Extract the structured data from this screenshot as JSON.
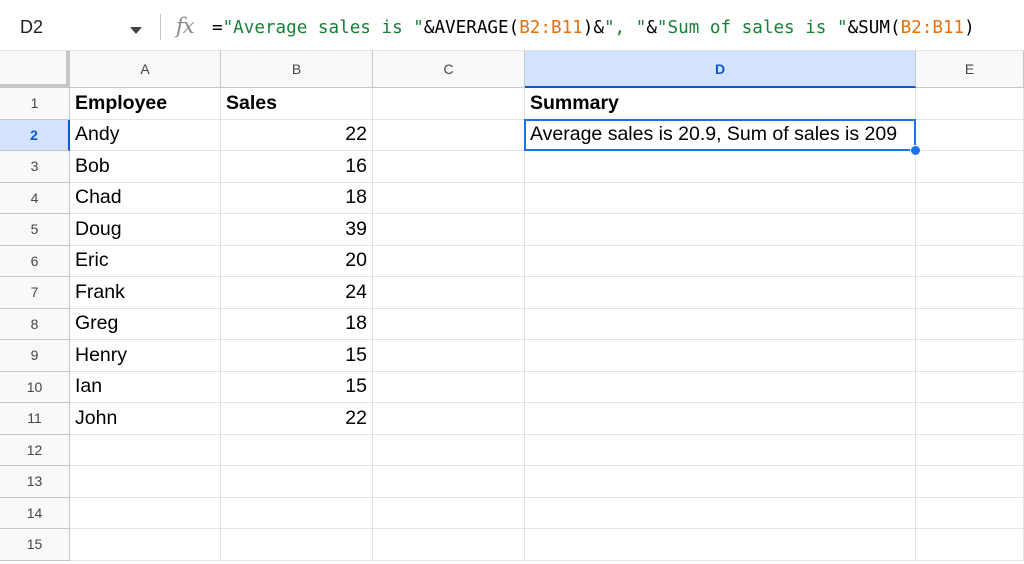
{
  "name_box": {
    "ref": "D2"
  },
  "formula_bar": {
    "fx_icon": "function-icon",
    "parts": [
      {
        "text": "=",
        "kind": "op"
      },
      {
        "text": "\"Average sales is \"",
        "kind": "str"
      },
      {
        "text": "&AVERAGE(",
        "kind": "op"
      },
      {
        "text": "B2:B11",
        "kind": "ref"
      },
      {
        "text": ")&",
        "kind": "op"
      },
      {
        "text": "\", \"",
        "kind": "str"
      },
      {
        "text": "&",
        "kind": "op"
      },
      {
        "text": "\"Sum of sales is \"",
        "kind": "str"
      },
      {
        "text": "&SUM(",
        "kind": "op"
      },
      {
        "text": "B2:B11",
        "kind": "ref"
      },
      {
        "text": ")",
        "kind": "op"
      }
    ]
  },
  "columns": [
    "A",
    "B",
    "C",
    "D",
    "E"
  ],
  "selected_column": "D",
  "rows": [
    "1",
    "2",
    "3",
    "4",
    "5",
    "6",
    "7",
    "8",
    "9",
    "10",
    "11",
    "12",
    "13",
    "14",
    "15"
  ],
  "selected_row": "2",
  "sheet": {
    "A": [
      "Employee",
      "Andy",
      "Bob",
      "Chad",
      "Doug",
      "Eric",
      "Frank",
      "Greg",
      "Henry",
      "Ian",
      "John",
      "",
      "",
      "",
      ""
    ],
    "B": [
      "Sales",
      "22",
      "16",
      "18",
      "39",
      "20",
      "24",
      "18",
      "15",
      "15",
      "22",
      "",
      "",
      "",
      ""
    ],
    "C": [
      "",
      "",
      "",
      "",
      "",
      "",
      "",
      "",
      "",
      "",
      "",
      "",
      "",
      "",
      ""
    ],
    "D": [
      "Summary",
      "Average sales is 20.9, Sum of sales is 209",
      "",
      "",
      "",
      "",
      "",
      "",
      "",
      "",
      "",
      "",
      "",
      "",
      ""
    ],
    "E": [
      "",
      "",
      "",
      "",
      "",
      "",
      "",
      "",
      "",
      "",
      "",
      "",
      "",
      "",
      ""
    ]
  },
  "colors": {
    "selection": "#1a73e8",
    "header_selected_bg": "#d3e3fd",
    "string": "#188038",
    "reference": "#e8710a"
  }
}
